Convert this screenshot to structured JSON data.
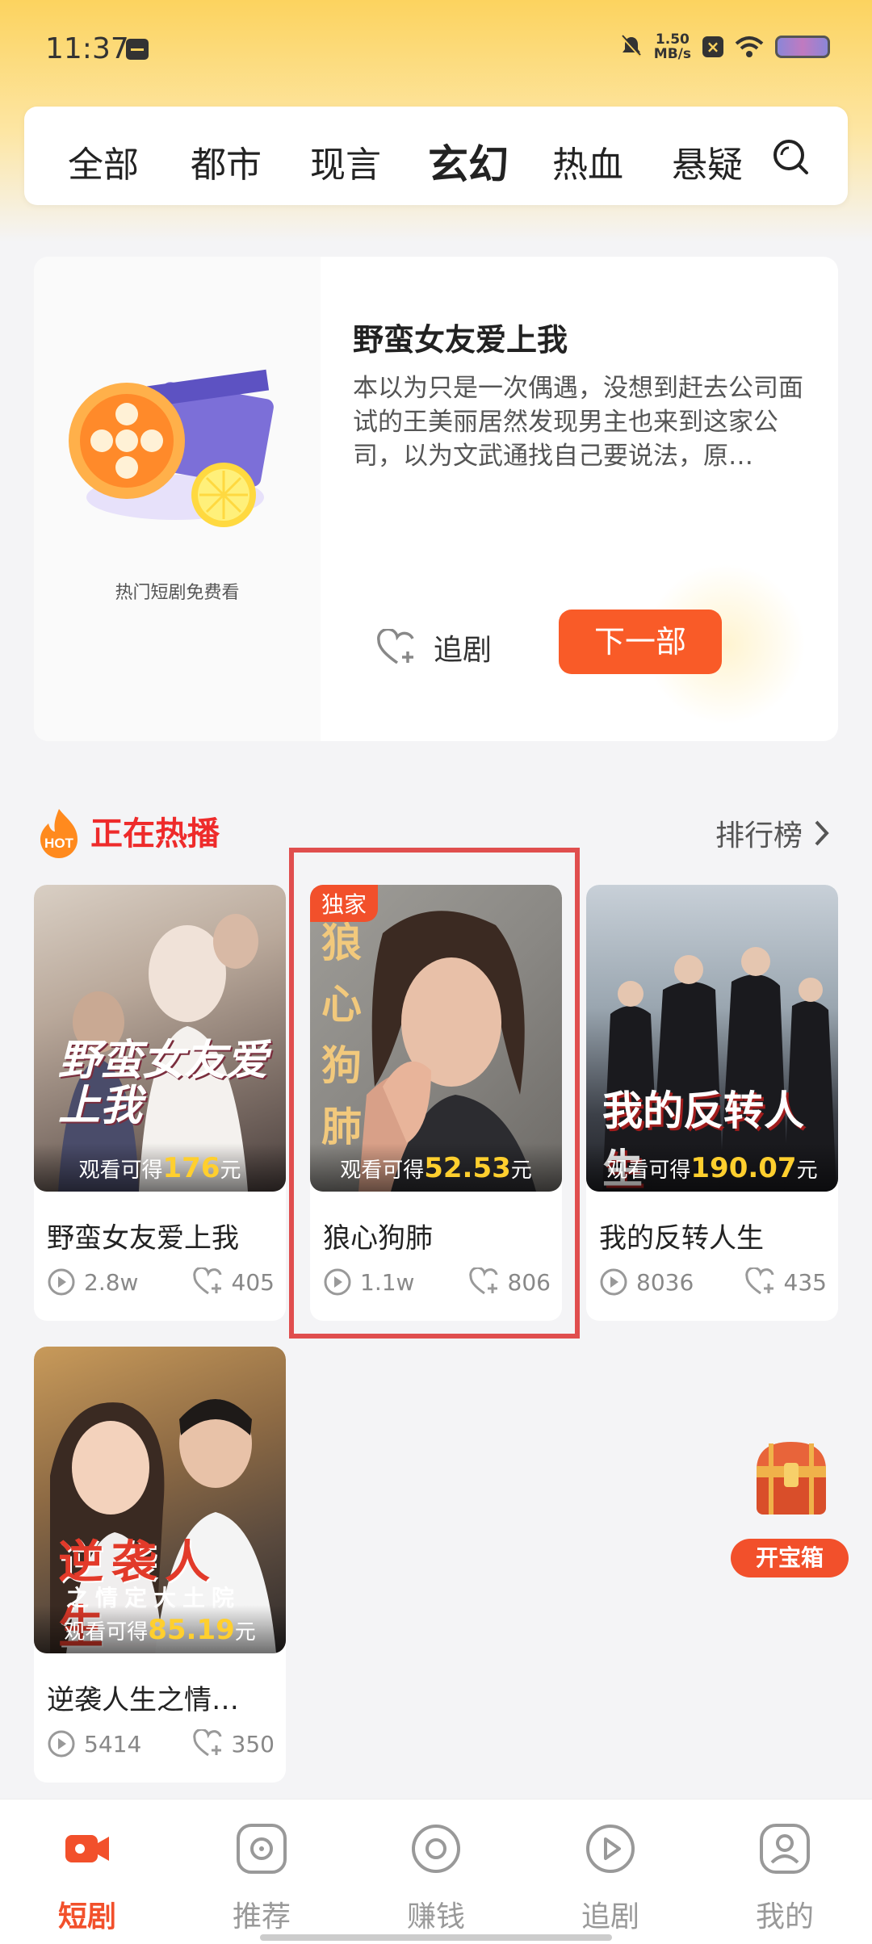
{
  "status": {
    "time": "11:37",
    "speed_top": "1.50",
    "speed_unit": "MB/s"
  },
  "nav": {
    "tabs": [
      "全部",
      "都市",
      "现言",
      "玄幻",
      "热血",
      "悬疑"
    ],
    "active": "玄幻"
  },
  "feature": {
    "poster_caption": "热门短剧免费看",
    "title": "野蛮女友爱上我",
    "description": "本以为只是一次偶遇，没想到赶去公司面试的王美丽居然发现男主也来到这家公司，以为文武通找自己要说法，原…",
    "follow_label": "追剧",
    "next_label": "下一部"
  },
  "section": {
    "hot_badge": "HOT",
    "title": "正在热播",
    "rank_label": "排行榜"
  },
  "cards": [
    {
      "name": "野蛮女友爱上我",
      "earn_prefix": "观看可得",
      "amount": "176",
      "unit": "元",
      "plays": "2.8w",
      "likes": "405",
      "badge": "",
      "poster_text": "野蛮女友爱上我"
    },
    {
      "name": "狼心狗肺",
      "earn_prefix": "观看可得",
      "amount": "52.53",
      "unit": "元",
      "plays": "1.1w",
      "likes": "806",
      "badge": "独家",
      "poster_text": "狼心狗肺"
    },
    {
      "name": "我的反转人生",
      "earn_prefix": "观看可得",
      "amount": "190.07",
      "unit": "元",
      "plays": "8036",
      "likes": "435",
      "badge": "",
      "poster_text": "我的反转人生"
    },
    {
      "name": "逆袭人生之情…",
      "earn_prefix": "观看可得",
      "amount": "85.19",
      "unit": "元",
      "plays": "5414",
      "likes": "350",
      "badge": "",
      "poster_text": "逆袭人生",
      "poster_sub": "之情定大土院"
    }
  ],
  "treasure": {
    "label": "开宝箱"
  },
  "bottom_nav": [
    {
      "label": "短剧",
      "icon": "camera-icon",
      "active": true
    },
    {
      "label": "推荐",
      "icon": "target-icon",
      "active": false
    },
    {
      "label": "赚钱",
      "icon": "coin-icon",
      "active": false
    },
    {
      "label": "追剧",
      "icon": "play-icon",
      "active": false
    },
    {
      "label": "我的",
      "icon": "user-icon",
      "active": false
    }
  ],
  "colors": {
    "accent": "#f95b28",
    "hot_title": "#ee2b2b",
    "amount": "#ffcf2e",
    "header_yellow": "#fcd35f"
  }
}
